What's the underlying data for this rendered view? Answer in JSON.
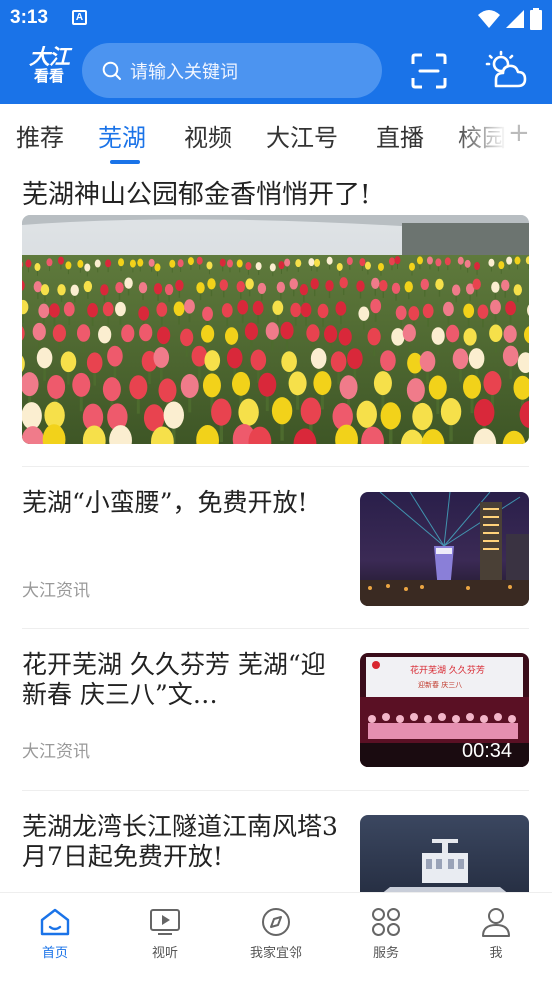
{
  "status_bar": {
    "time": "3:13",
    "notification_glyph": "A"
  },
  "header": {
    "logo_line1": "大江",
    "logo_line2": "看看",
    "search_placeholder": "请输入关键词",
    "icons": [
      "search-icon",
      "scan-icon",
      "weather-icon"
    ]
  },
  "tabs": [
    {
      "label": "推荐"
    },
    {
      "label": "芜湖",
      "active": true
    },
    {
      "label": "视频"
    },
    {
      "label": "大江号"
    },
    {
      "label": "直播"
    },
    {
      "label": "校园"
    }
  ],
  "tab_more": "+",
  "feed": {
    "headline": "芜湖神山公园郁金香悄悄开了!",
    "items": [
      {
        "title": "芜湖“小蛮腰”，免费开放!",
        "source": "大江资讯"
      },
      {
        "title": "花开芜湖 久久芬芳 芜湖“迎新春 庆三八”文…",
        "source": "大江资讯",
        "duration": "00:34"
      },
      {
        "title": "芜湖龙湾长江隧道江南风塔3月7日起免费开放!"
      }
    ],
    "banner_text_1": "花开芜湖 久久芬芳",
    "banner_text_2": "迎新春 庆三八"
  },
  "bottom_nav": [
    {
      "label": "首页",
      "icon": "home-icon",
      "active": true
    },
    {
      "label": "视听",
      "icon": "video-icon"
    },
    {
      "label": "我家宜邻",
      "icon": "compass-icon"
    },
    {
      "label": "服务",
      "icon": "grid-icon"
    },
    {
      "label": "我",
      "icon": "person-icon"
    }
  ],
  "colors": {
    "brand_blue": "#1a73e8",
    "search_bg": "#4c94f0"
  }
}
